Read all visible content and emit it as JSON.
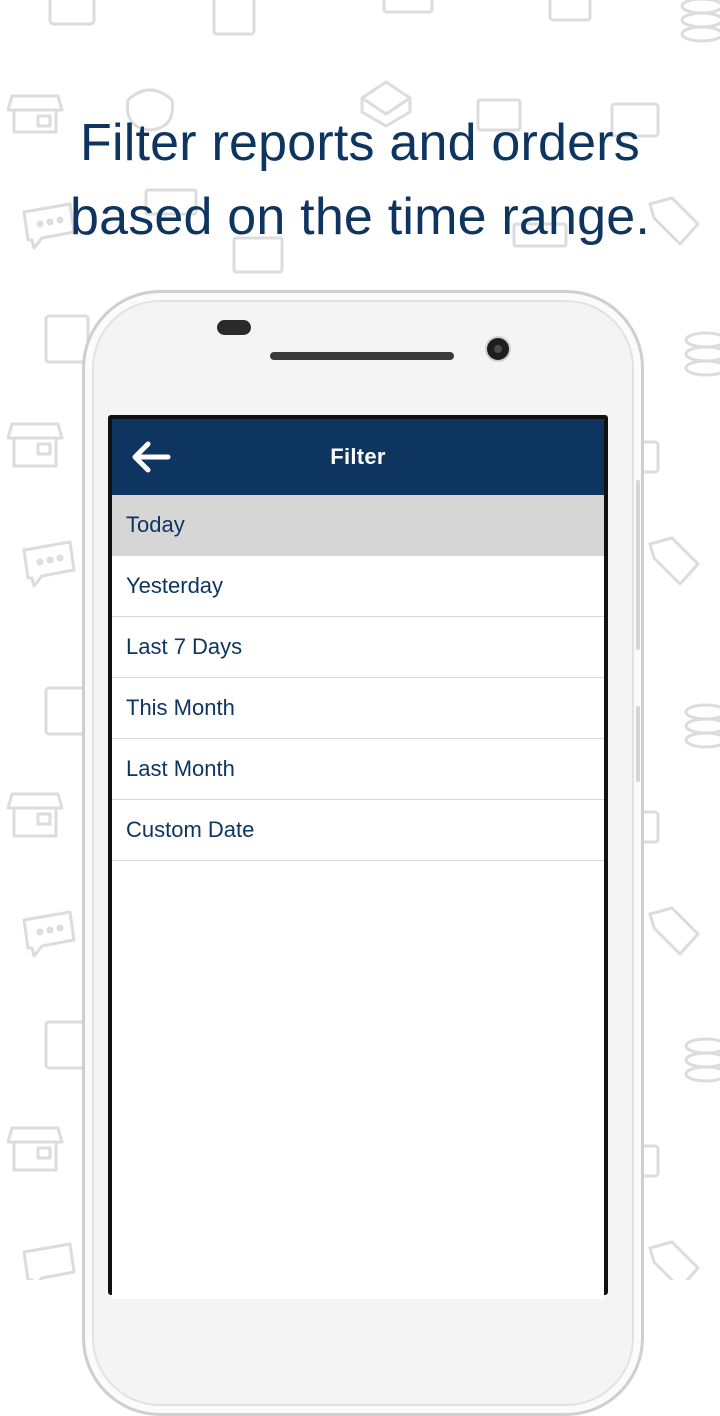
{
  "headline": {
    "line1": "Filter reports and orders",
    "line2": "based on the time range."
  },
  "app": {
    "title": "Filter",
    "back_icon": "arrow-left-icon",
    "colors": {
      "primary": "#0e3560",
      "selected_row": "#d6d6d6",
      "divider": "#d8d8d8"
    }
  },
  "filter_options": [
    {
      "label": "Today",
      "selected": true
    },
    {
      "label": "Yesterday",
      "selected": false
    },
    {
      "label": "Last 7 Days",
      "selected": false
    },
    {
      "label": "This Month",
      "selected": false
    },
    {
      "label": "Last Month",
      "selected": false
    },
    {
      "label": "Custom Date",
      "selected": false
    }
  ]
}
